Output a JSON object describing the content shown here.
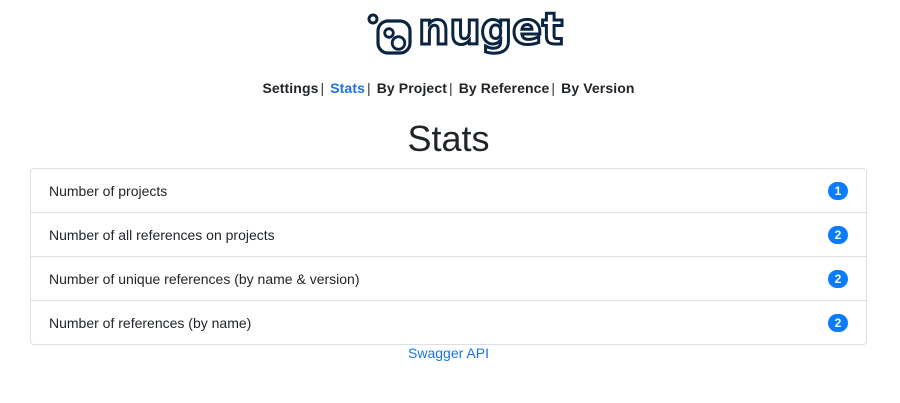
{
  "logo": {
    "text": "nuget",
    "icon": "nuget-logo-icon",
    "color": "#0b2540"
  },
  "nav": {
    "items": [
      {
        "label": "Settings",
        "active": false
      },
      {
        "label": "Stats",
        "active": true
      },
      {
        "label": "By Project",
        "active": false
      },
      {
        "label": "By Reference",
        "active": false
      },
      {
        "label": "By Version",
        "active": false
      }
    ],
    "separator": "|",
    "active_color": "#1a73e8"
  },
  "page": {
    "title": "Stats"
  },
  "stats": {
    "rows": [
      {
        "label": "Number of projects",
        "value": "1"
      },
      {
        "label": "Number of all references on projects",
        "value": "2"
      },
      {
        "label": "Number of unique references (by name & version)",
        "value": "2"
      },
      {
        "label": "Number of references (by name)",
        "value": "2"
      }
    ],
    "badge_color": "#0b7bff"
  },
  "footer": {
    "link_label": "Swagger API"
  }
}
